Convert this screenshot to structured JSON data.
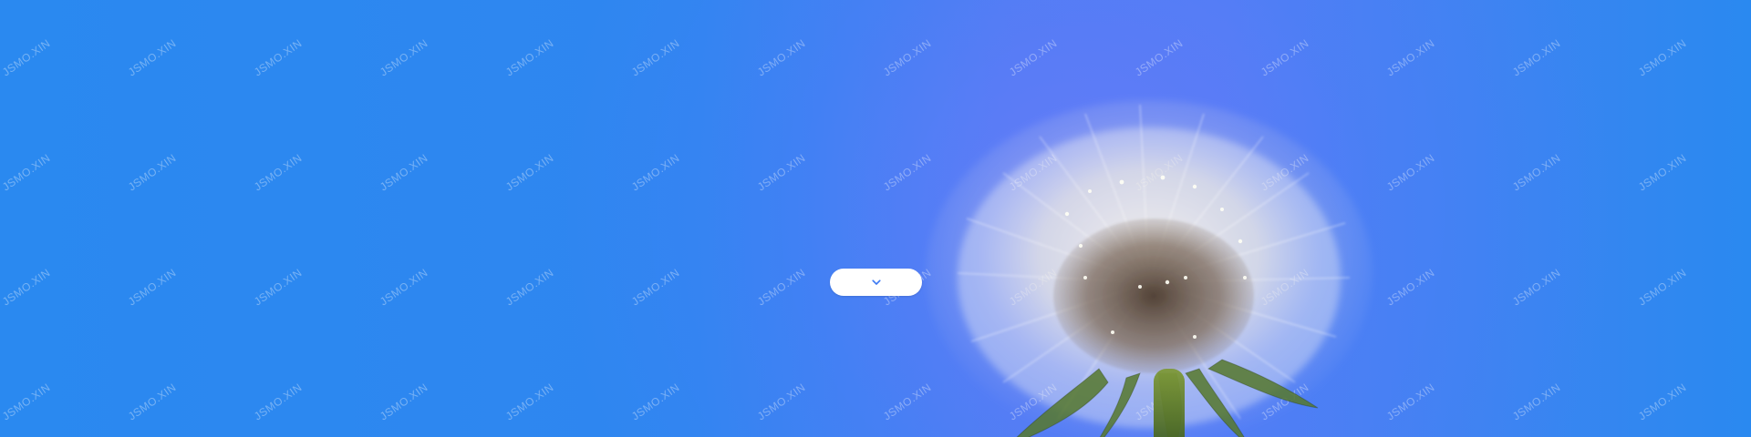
{
  "watermark": {
    "text": "JSMO.XIN"
  },
  "hero": {
    "subject": "dandelion seed head"
  },
  "scroll_control": {
    "icon": "chevron-down-icon",
    "accent": "#3b78f2"
  },
  "colors": {
    "sky": "#2a89f0",
    "sky_mid": "#4f7ff2",
    "pill": "#ffffff"
  }
}
